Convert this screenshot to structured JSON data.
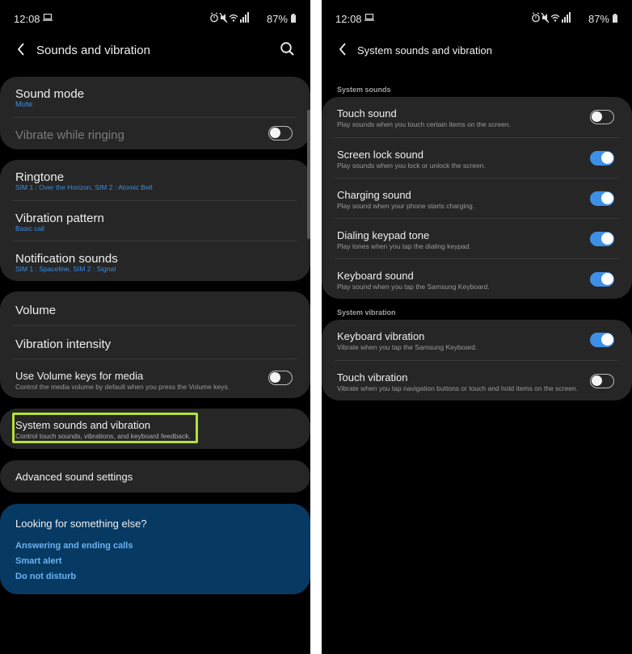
{
  "left": {
    "status": {
      "time": "12:08",
      "battery": "87%"
    },
    "header": {
      "title": "Sounds and vibration"
    },
    "group1": {
      "sound_mode": {
        "label": "Sound mode",
        "value": "Mute"
      },
      "vibrate_ringing": {
        "label": "Vibrate while ringing",
        "toggle": "off"
      }
    },
    "group2": {
      "ringtone": {
        "label": "Ringtone",
        "value": "SIM 1 : Over the Horizon, SIM 2 : Atomic Bell"
      },
      "vibration_pattern": {
        "label": "Vibration pattern",
        "value": "Basic call"
      },
      "notification_sounds": {
        "label": "Notification sounds",
        "value": "SIM 1 : Spaceline, SIM 2 : Signal"
      }
    },
    "group3": {
      "volume": {
        "label": "Volume"
      },
      "vibration_intensity": {
        "label": "Vibration intensity"
      },
      "volume_keys": {
        "label": "Use Volume keys for media",
        "desc": "Control the media volume by default when you press the Volume keys.",
        "toggle": "off"
      }
    },
    "system_sounds": {
      "label": "System sounds and vibration",
      "desc": "Control touch sounds, vibrations, and keyboard feedback."
    },
    "advanced": {
      "label": "Advanced sound settings"
    },
    "suggestions": {
      "question": "Looking for something else?",
      "links": [
        "Answering and ending calls",
        "Smart alert",
        "Do not disturb"
      ]
    }
  },
  "right": {
    "status": {
      "time": "12:08",
      "battery": "87%"
    },
    "header": {
      "title": "System sounds and vibration"
    },
    "system_sounds_header": "System sounds",
    "system_sounds": [
      {
        "label": "Touch sound",
        "desc": "Play sounds when you touch certain items on the screen.",
        "toggle": "off"
      },
      {
        "label": "Screen lock sound",
        "desc": "Play sounds when you lock or unlock the screen.",
        "toggle": "on"
      },
      {
        "label": "Charging sound",
        "desc": "Play sound when your phone starts charging.",
        "toggle": "on"
      },
      {
        "label": "Dialing keypad tone",
        "desc": "Play tones when you tap the dialing keypad.",
        "toggle": "on"
      },
      {
        "label": "Keyboard sound",
        "desc": "Play sound when you tap the Samsung Keyboard.",
        "toggle": "on"
      }
    ],
    "system_vibration_header": "System vibration",
    "system_vibration": [
      {
        "label": "Keyboard vibration",
        "desc": "Vibrate when you tap the Samsung Keyboard.",
        "toggle": "on"
      },
      {
        "label": "Touch vibration",
        "desc": "Vibrate when you tap navigation buttons or touch and hold items on the screen.",
        "toggle": "off"
      }
    ]
  },
  "colors": {
    "accent": "#3e8fe6",
    "card": "#262626",
    "highlight": "#b5e03b",
    "suggestion_card": "#063a63"
  }
}
